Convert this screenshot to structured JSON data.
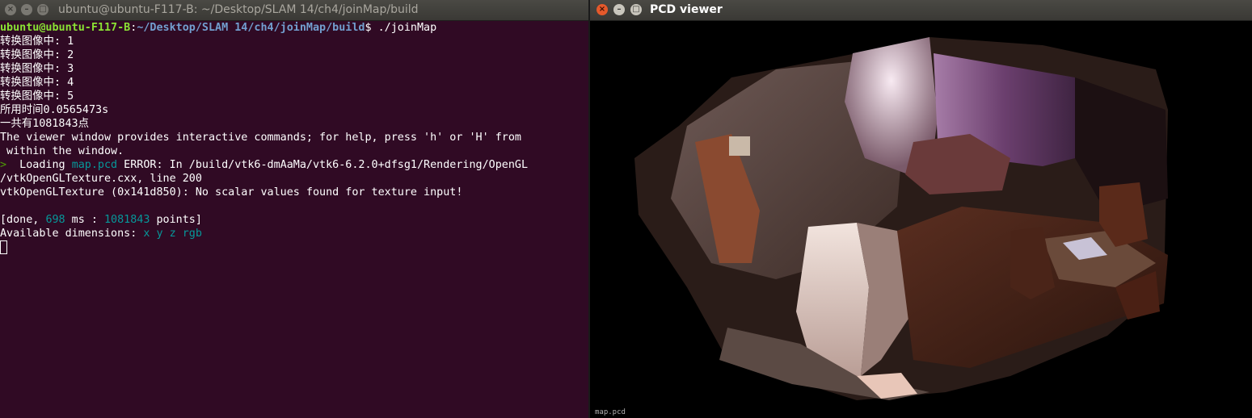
{
  "terminal": {
    "title": "ubuntu@ubuntu-F117-B: ~/Desktop/SLAM 14/ch4/joinMap/build",
    "prompt_user": "ubuntu@ubuntu-F117-B",
    "prompt_sep": ":",
    "prompt_path": "~/Desktop/SLAM 14/ch4/joinMap/build",
    "prompt_suffix": "$ ./joinMap",
    "lines": [
      "转换图像中: 1",
      "转换图像中: 2",
      "转换图像中: 3",
      "转换图像中: 4",
      "转换图像中: 5",
      "所用时间0.0565473s",
      "一共有1081843点",
      "The viewer window provides interactive commands; for help, press 'h' or 'H' from",
      " within the window."
    ],
    "loading_prefix": "> ",
    "loading_word": " Loading ",
    "loading_file": "map.pcd",
    "loading_error": " ERROR: In /build/vtk6-dmAaMa/vtk6-6.2.0+dfsg1/Rendering/OpenGL",
    "error_line2": "/vtkOpenGLTexture.cxx, line 200",
    "error_line3": "vtkOpenGLTexture (0x141d850): No scalar values found for texture input!",
    "done_open": "[done, ",
    "done_ms": "698",
    "done_mid": " ms : ",
    "done_points": "1081843",
    "done_close": " points]",
    "dims_label": "Available dimensions: ",
    "dims_value": "x y z rgb"
  },
  "viewer": {
    "title": "PCD viewer",
    "overlay_label": "map.pcd"
  },
  "window_controls": {
    "close": "×",
    "minimize": "–",
    "maximize": "□"
  }
}
